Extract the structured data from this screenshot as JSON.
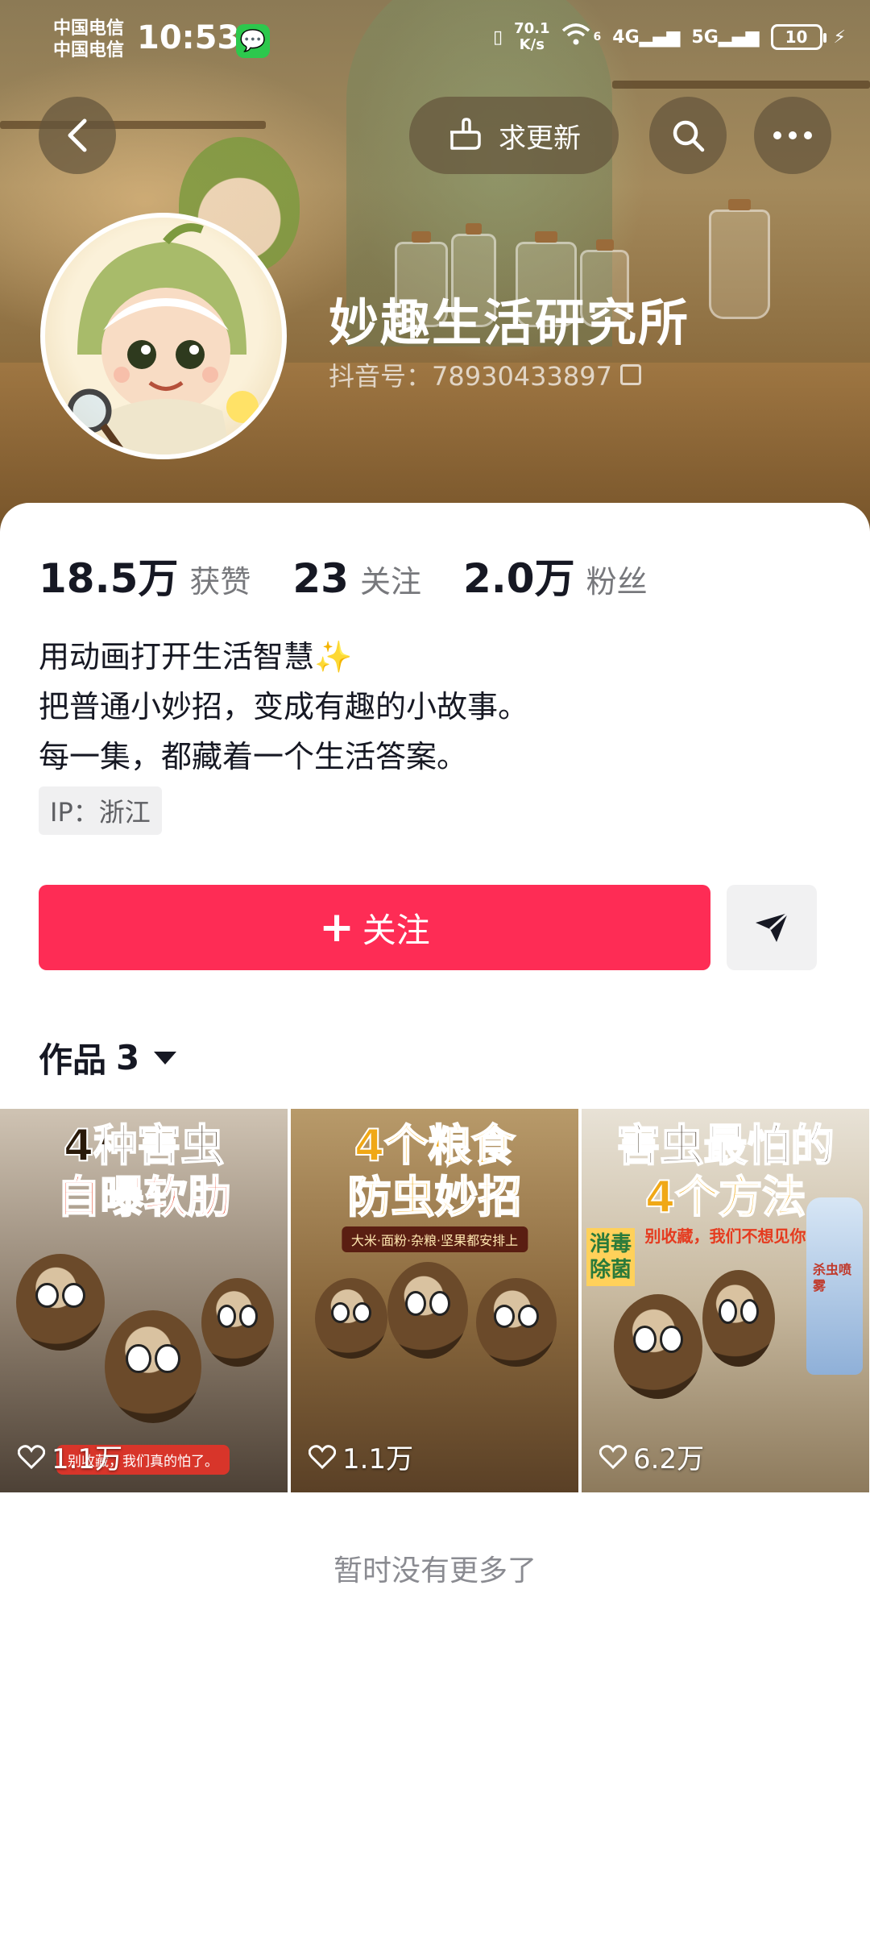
{
  "status_bar": {
    "carrier_1": "中国电信",
    "carrier_2": "中国电信",
    "time": "10:53",
    "net_speed_value": "70.1",
    "net_speed_unit": "K/s",
    "wifi_badge": "6",
    "cell_1": "4G",
    "cell_2": "5G",
    "battery": "10"
  },
  "nav": {
    "request_update_label": "求更新"
  },
  "profile": {
    "name": "妙趣生活研究所",
    "id_label": "抖音号：78930433897",
    "stats": [
      {
        "value": "18.5万",
        "label": "获赞"
      },
      {
        "value": "23",
        "label": "关注"
      },
      {
        "value": "2.0万",
        "label": "粉丝"
      }
    ],
    "bio_lines": [
      "用动画打开生活智慧✨",
      "把普通小妙招，变成有趣的小故事。",
      "每一集，都藏着一个生活答案。"
    ],
    "ip_label": "IP：浙江"
  },
  "actions": {
    "follow_label": "关注"
  },
  "works": {
    "header_label": "作品",
    "count": "3",
    "items": [
      {
        "title_line1": "4种害虫",
        "title_line2": "自曝软肋",
        "banner": "别收藏，我们真的怕了。",
        "likes": "1.1万"
      },
      {
        "title_line1": "4个粮食",
        "title_line2": "防虫妙招",
        "subtitle": "大米·面粉·杂粮·坚果都安排上",
        "likes": "1.1万"
      },
      {
        "title_line1": "害虫最怕的",
        "title_line2": "4个方法",
        "subtitle": "别收藏，我们不想见你",
        "side_label": "消毒除菌",
        "bottle_label": "杀虫喷雾",
        "likes": "6.2万"
      }
    ]
  },
  "footer": {
    "no_more_text": "暂时没有更多了"
  },
  "colors": {
    "accent": "#fe2c55",
    "text_primary": "#161823",
    "text_secondary": "#77787c"
  }
}
